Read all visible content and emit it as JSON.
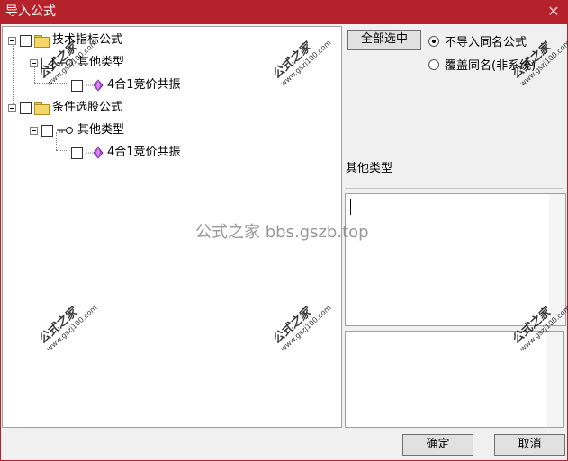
{
  "window": {
    "title": "导入公式",
    "close_glyph": "✕"
  },
  "tree": {
    "items": [
      {
        "label": "技术指标公式",
        "icon": "folder-icon"
      },
      {
        "label": "其他类型",
        "icon": "key-icon"
      },
      {
        "label": "4合1竞价共振",
        "icon": "gem-icon"
      },
      {
        "label": "条件选股公式",
        "icon": "folder-icon"
      },
      {
        "label": "其他类型",
        "icon": "key-icon"
      },
      {
        "label": "4合1竞价共振",
        "icon": "gem-icon"
      }
    ]
  },
  "options": {
    "select_all_label": "全部选中",
    "radio_skip_label": "不导入同名公式",
    "radio_overwrite_label": "覆盖同名(非系统)",
    "selected": "skip"
  },
  "detail": {
    "type_label": "其他类型"
  },
  "footer": {
    "ok_label": "确定",
    "cancel_label": "取消"
  },
  "watermarks": {
    "brand": "公式之家",
    "url": "www.gszj100.com",
    "center_text": "公式之家 bbs.gszb.top"
  },
  "colors": {
    "titlebar": "#b5222b",
    "folder": "#f5d66b",
    "gem": "#b04ad8"
  }
}
